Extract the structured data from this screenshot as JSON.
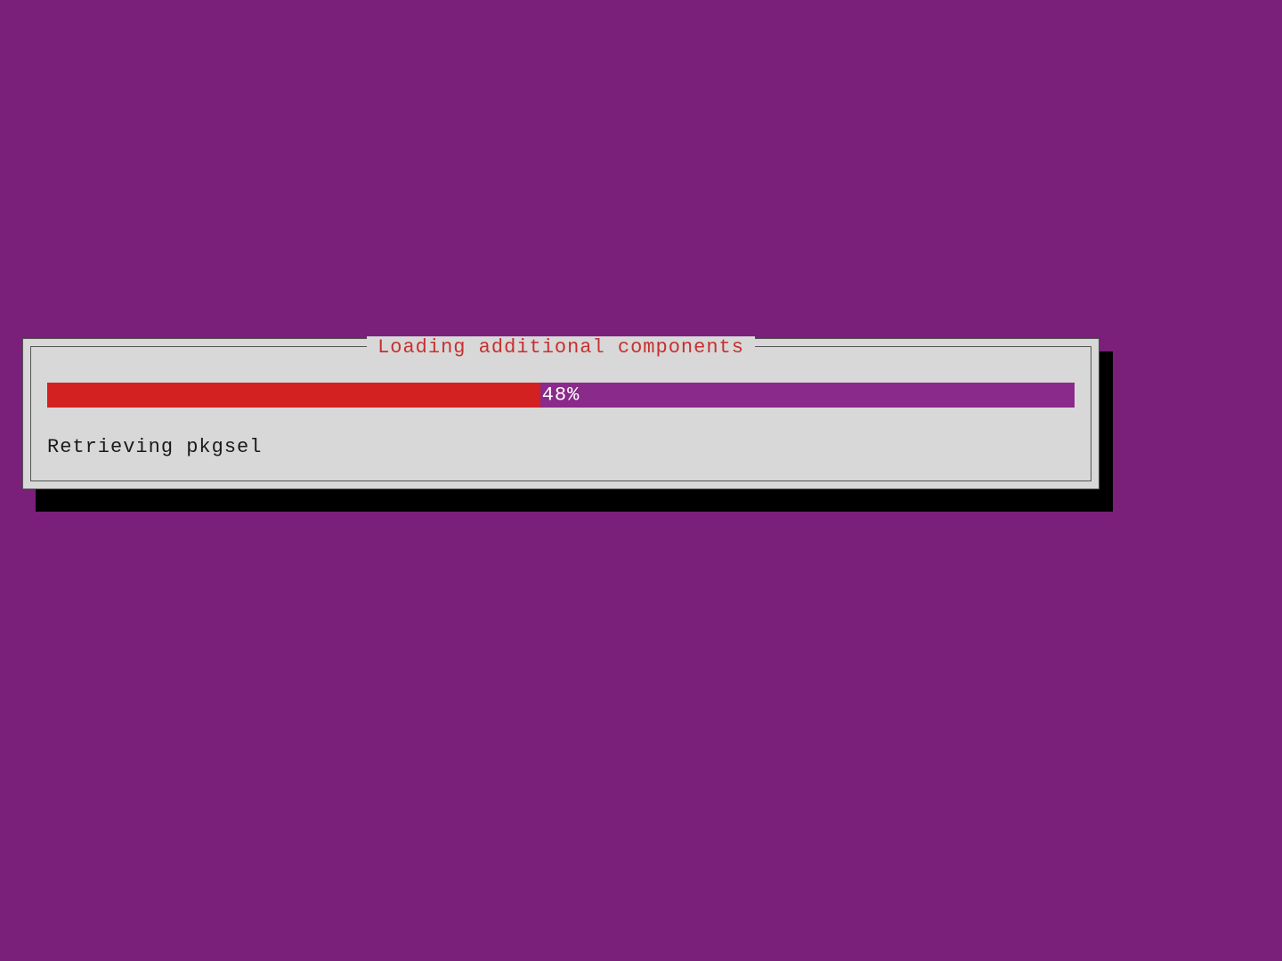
{
  "dialog": {
    "title": "Loading additional components",
    "progress_percent": 48,
    "progress_label": "48%",
    "status_text": "Retrieving pkgsel"
  },
  "colors": {
    "background": "#7a1f7a",
    "dialog_bg": "#d8d8d8",
    "progress_fill": "#d32020",
    "progress_track": "#8a2a8a",
    "title_color": "#c83030"
  }
}
